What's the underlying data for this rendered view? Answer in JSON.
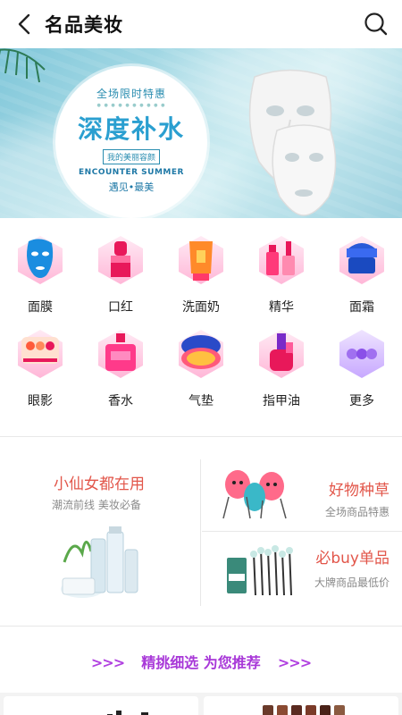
{
  "header": {
    "title": "名品美妆"
  },
  "banner": {
    "line1": "全场限时特惠",
    "big_text": "深度补水",
    "tag": "我的美丽容颜",
    "english": "ENCOUNTER SUMMER",
    "slogan": "遇见•最美",
    "page_count": 2,
    "active_page": 2
  },
  "categories": [
    {
      "label": "面膜",
      "icon": "face-mask-icon"
    },
    {
      "label": "口红",
      "icon": "lipstick-icon"
    },
    {
      "label": "洗面奶",
      "icon": "cleanser-icon"
    },
    {
      "label": "精华",
      "icon": "serum-icon"
    },
    {
      "label": "面霜",
      "icon": "cream-icon"
    },
    {
      "label": "眼影",
      "icon": "eyeshadow-icon"
    },
    {
      "label": "香水",
      "icon": "perfume-icon"
    },
    {
      "label": "气垫",
      "icon": "cushion-icon"
    },
    {
      "label": "指甲油",
      "icon": "nail-polish-icon"
    },
    {
      "label": "更多",
      "icon": "more-icon"
    }
  ],
  "promos": {
    "left": {
      "title": "小仙女都在用",
      "subtitle": "潮流前线   美妆必备"
    },
    "right_top": {
      "title": "好物种草",
      "subtitle": "全场商品特惠"
    },
    "right_bottom": {
      "title": "必buy单品",
      "subtitle": "大牌商品最低价"
    }
  },
  "recommend": {
    "arrows_left": ">>>",
    "title": "精挑细选  为您推荐",
    "arrows_right": ">>>"
  },
  "colors": {
    "accent_red": "#e2564a",
    "accent_purple": "#a838d8",
    "category_gradient": "#ff5fa8"
  }
}
